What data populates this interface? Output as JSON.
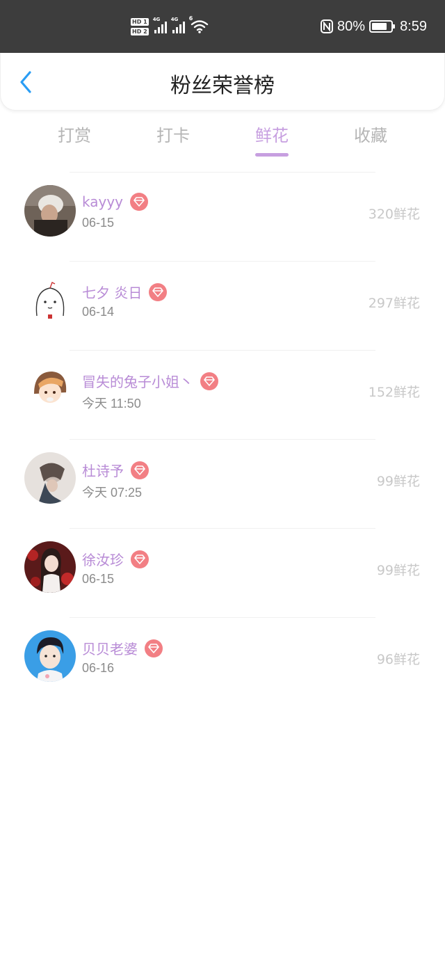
{
  "status_bar": {
    "hd1": "HD 1",
    "hd2": "HD 2",
    "network1": "4G",
    "network2": "4G",
    "wifi_badge": "6",
    "battery_text": "80%",
    "battery_level": 0.8,
    "time": "8:59",
    "icons": [
      "hd-icon",
      "signal-icon",
      "signal-icon",
      "wifi-icon",
      "nfc-icon",
      "battery-icon"
    ]
  },
  "header": {
    "title": "粉丝荣誉榜",
    "back_icon": "chevron-left-icon",
    "accent": "#2a9df4"
  },
  "tabs": [
    {
      "label": "打赏",
      "active": false
    },
    {
      "label": "打卡",
      "active": false
    },
    {
      "label": "鲜花",
      "active": true
    },
    {
      "label": "收藏",
      "active": false
    }
  ],
  "colors": {
    "active_tab": "#c79fe0",
    "name": "#b88bd6",
    "badge": "#f27f84",
    "status_bar": "#3d3d3d"
  },
  "list": [
    {
      "name": "kayyy",
      "time": "06-15",
      "flowers": "320鲜花"
    },
    {
      "name": "七夕 炎日",
      "time": "06-14",
      "flowers": "297鲜花"
    },
    {
      "name": "冒失的兔子小姐丶",
      "time": "今天 11:50",
      "flowers": "152鲜花"
    },
    {
      "name": "杜诗予",
      "time": "今天 07:25",
      "flowers": "99鲜花"
    },
    {
      "name": "徐汝珍",
      "time": "06-15",
      "flowers": "99鲜花"
    },
    {
      "name": "贝贝老婆",
      "time": "06-16",
      "flowers": "96鲜花"
    }
  ]
}
